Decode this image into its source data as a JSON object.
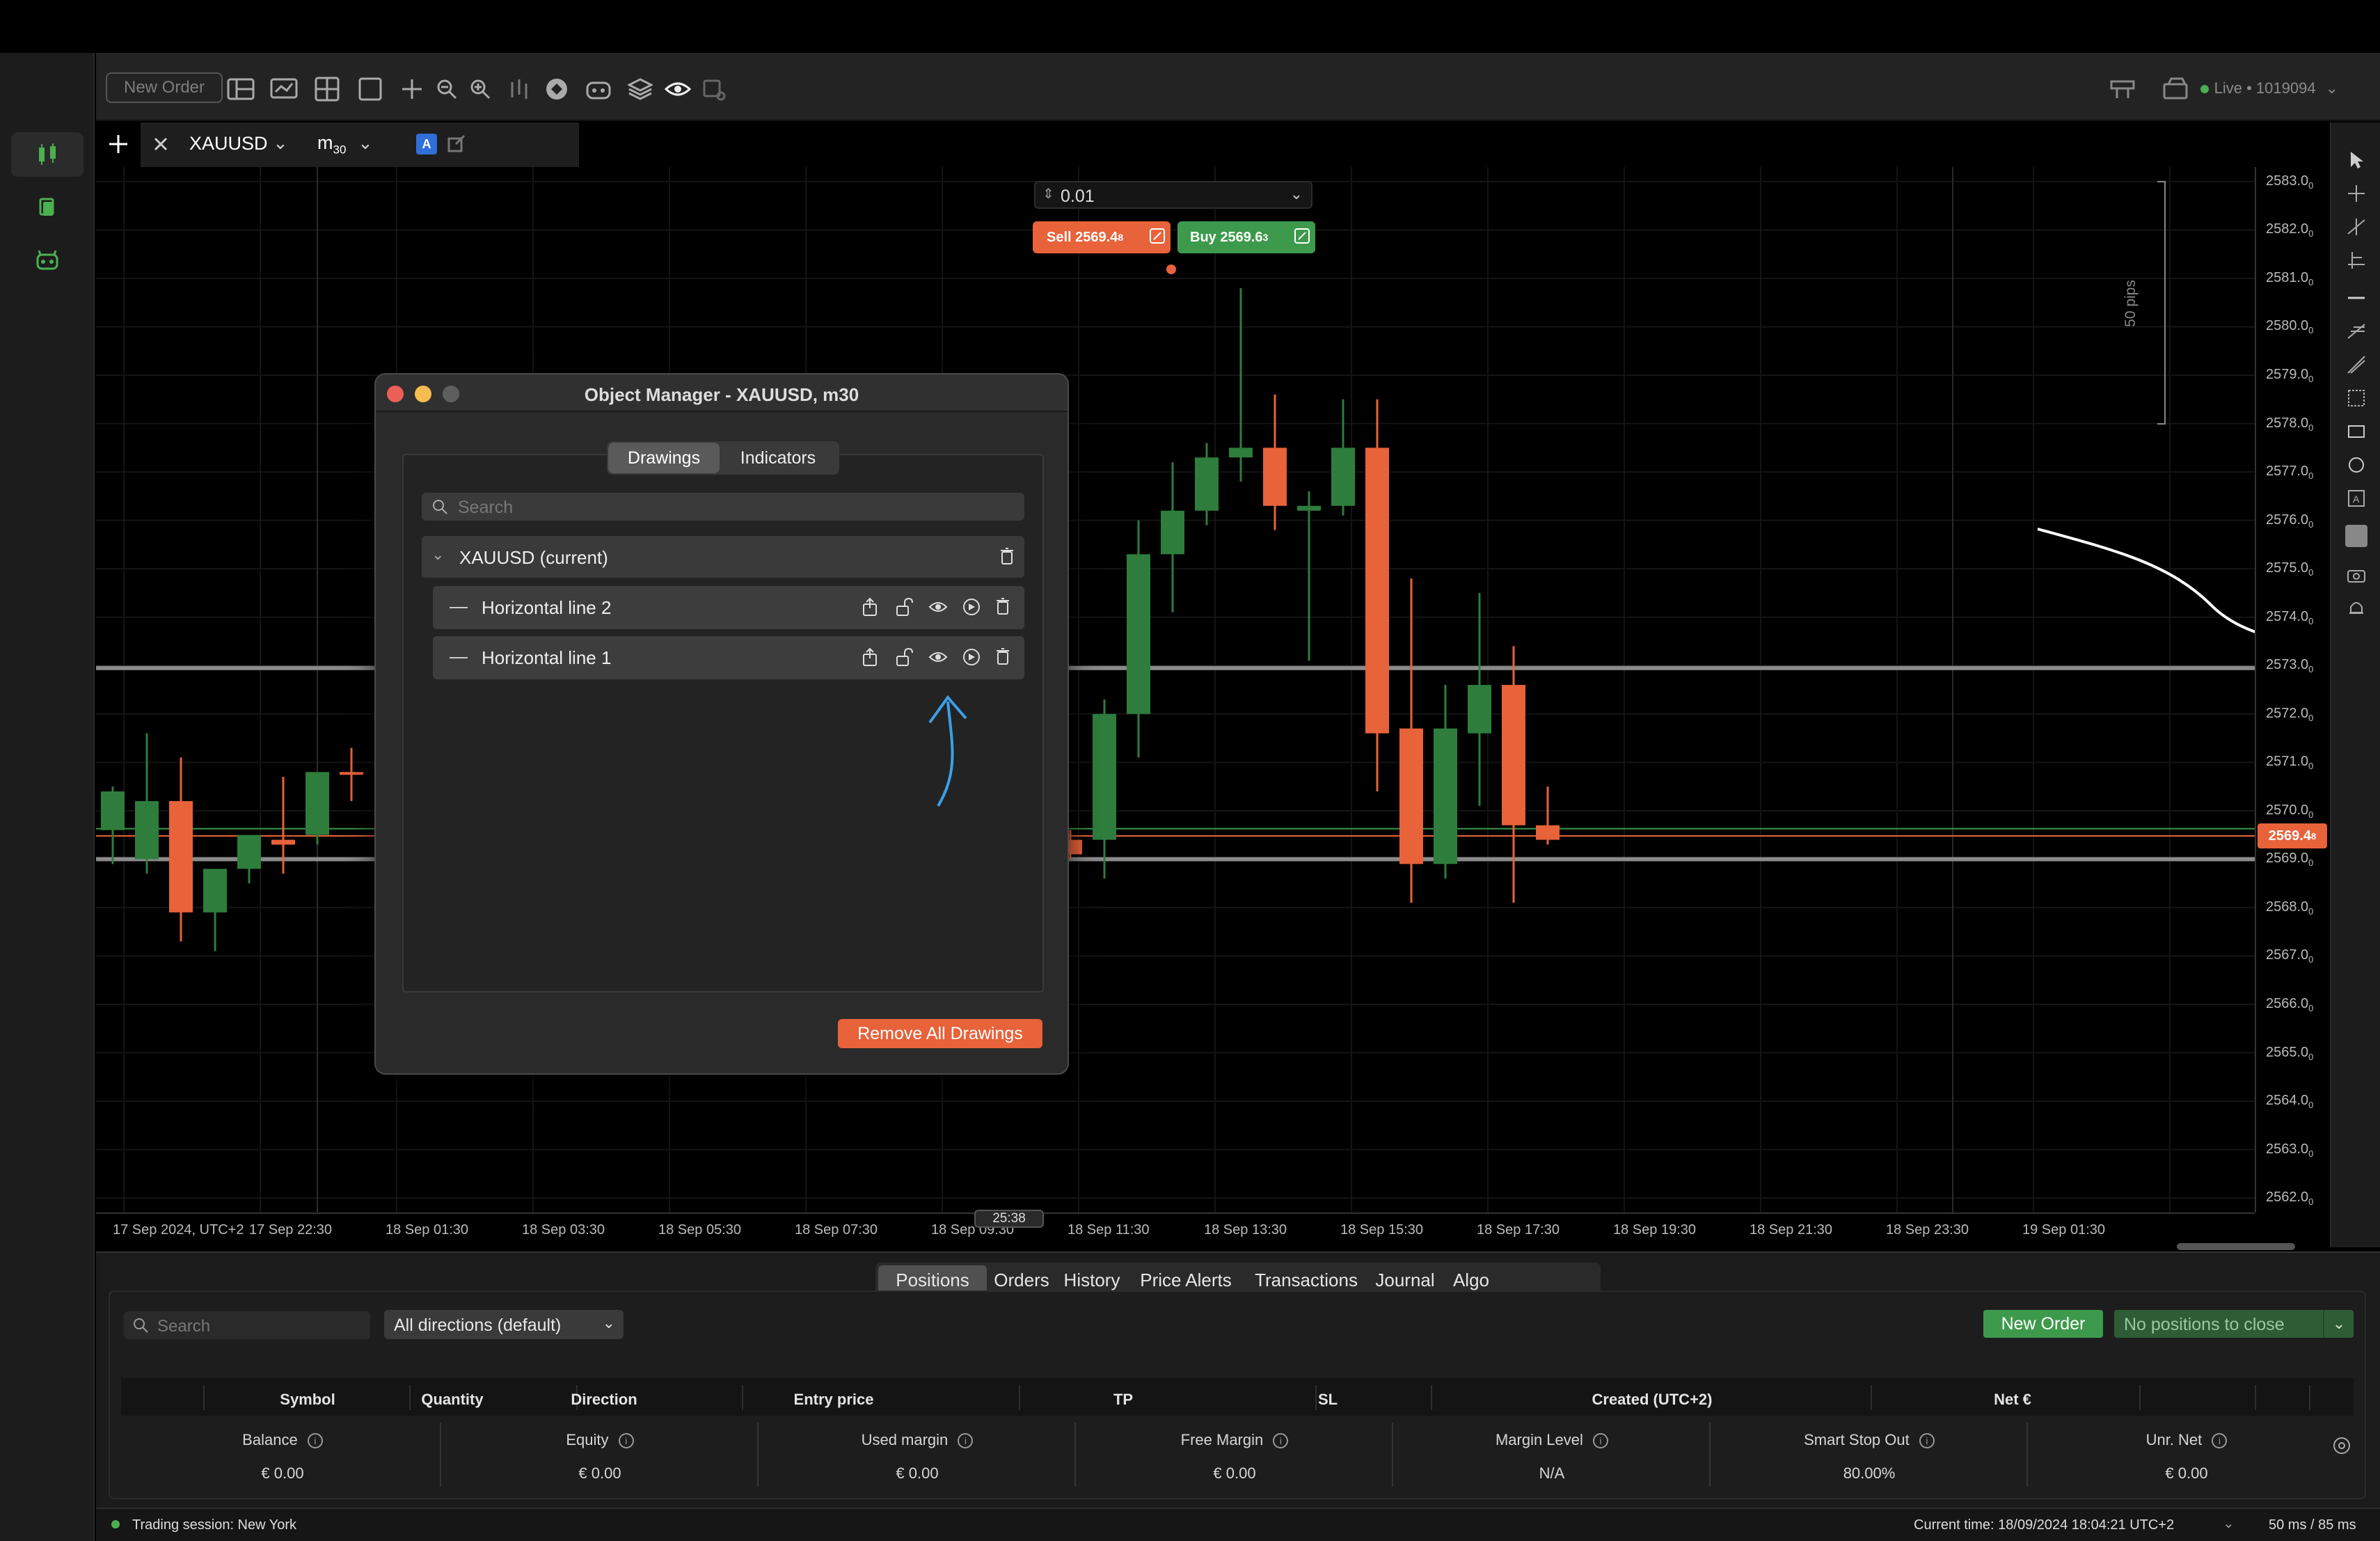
{
  "toolbar": {
    "new_order": "New Order",
    "live_status": "Live • 1019094"
  },
  "chart_tab": {
    "symbol": "XAUUSD",
    "timeframe_main": "m",
    "timeframe_sub": "30",
    "chart_label": "A"
  },
  "trade_widget": {
    "lot_size": "0.01",
    "sell_label": "Sell 2569.4",
    "sell_sup": "8",
    "buy_label": "Buy 2569.6",
    "buy_sup": "3"
  },
  "pips_label": "50 pips",
  "price_axis": {
    "ticks": [
      "2583.0",
      "2582.0",
      "2581.0",
      "2580.0",
      "2579.0",
      "2578.0",
      "2577.0",
      "2576.0",
      "2575.0",
      "2574.0",
      "2573.0",
      "2572.0",
      "2571.0",
      "2570.0",
      "2569.0",
      "2568.0",
      "2567.0",
      "2566.0",
      "2565.0",
      "2564.0",
      "2563.0",
      "2562.0"
    ],
    "tick_sup": "0",
    "current_price": "2569.4",
    "current_sup": "8"
  },
  "time_axis": {
    "labels": [
      "17 Sep 2024, UTC+2",
      "17 Sep 22:30",
      "18 Sep 01:30",
      "18 Sep 03:30",
      "18 Sep 05:30",
      "18 Sep 07:30",
      "18 Sep 09:30",
      "18 Sep 11:30",
      "18 Sep 13:30",
      "18 Sep 15:30",
      "18 Sep 17:30",
      "18 Sep 19:30",
      "18 Sep 21:30",
      "18 Sep 23:30",
      "19 Sep 01:30"
    ],
    "countdown": "25:38"
  },
  "chart_data": {
    "type": "candlestick",
    "symbol": "XAUUSD",
    "timeframe": "m30",
    "ylim": [
      2561.7,
      2583.3
    ],
    "horizontal_lines": [
      2572.95,
      2569.0
    ],
    "current_price": 2569.48,
    "candles_left": [
      {
        "o": 2569.6,
        "h": 2570.5,
        "l": 2568.9,
        "c": 2570.4
      },
      {
        "o": 2569.0,
        "h": 2571.6,
        "l": 2568.7,
        "c": 2570.2
      },
      {
        "o": 2570.2,
        "h": 2571.1,
        "l": 2567.3,
        "c": 2567.9
      },
      {
        "o": 2567.9,
        "h": 2568.4,
        "l": 2567.1,
        "c": 2568.8
      },
      {
        "o": 2568.8,
        "h": 2569.1,
        "l": 2568.5,
        "c": 2569.5
      },
      {
        "o": 2569.4,
        "h": 2570.7,
        "l": 2568.7,
        "c": 2569.3
      },
      {
        "o": 2569.5,
        "h": 2570.5,
        "l": 2569.3,
        "c": 2570.8
      },
      {
        "o": 2570.8,
        "h": 2571.3,
        "l": 2570.2,
        "c": 2570.75
      }
    ],
    "candles_right": [
      {
        "o": 2569.4,
        "h": 2569.6,
        "l": 2569.0,
        "c": 2569.1
      },
      {
        "o": 2569.4,
        "h": 2572.3,
        "l": 2568.6,
        "c": 2572.0
      },
      {
        "o": 2572.0,
        "h": 2576.0,
        "l": 2571.1,
        "c": 2575.3
      },
      {
        "o": 2575.3,
        "h": 2577.2,
        "l": 2574.1,
        "c": 2576.2
      },
      {
        "o": 2576.2,
        "h": 2577.6,
        "l": 2575.9,
        "c": 2577.3
      },
      {
        "o": 2577.3,
        "h": 2580.8,
        "l": 2576.8,
        "c": 2577.5
      },
      {
        "o": 2577.5,
        "h": 2578.6,
        "l": 2575.8,
        "c": 2576.3
      },
      {
        "o": 2576.2,
        "h": 2576.6,
        "l": 2573.1,
        "c": 2576.3
      },
      {
        "o": 2576.3,
        "h": 2578.5,
        "l": 2576.1,
        "c": 2577.5
      },
      {
        "o": 2577.5,
        "h": 2578.5,
        "l": 2570.4,
        "c": 2571.6
      },
      {
        "o": 2571.7,
        "h": 2574.8,
        "l": 2568.1,
        "c": 2568.9
      },
      {
        "o": 2568.9,
        "h": 2572.6,
        "l": 2568.6,
        "c": 2571.7
      },
      {
        "o": 2571.6,
        "h": 2574.5,
        "l": 2570.1,
        "c": 2572.6
      },
      {
        "o": 2572.6,
        "h": 2573.4,
        "l": 2568.1,
        "c": 2569.7
      },
      {
        "o": 2569.7,
        "h": 2570.5,
        "l": 2569.3,
        "c": 2569.4
      }
    ]
  },
  "dialog": {
    "title": "Object Manager - XAUUSD, m30",
    "tabs": [
      "Drawings",
      "Indicators"
    ],
    "search_placeholder": "Search",
    "group_label": "XAUUSD (current)",
    "items": [
      "Horizontal line 2",
      "Horizontal line 1"
    ],
    "remove_all": "Remove All Drawings"
  },
  "bottom": {
    "tabs": [
      "Positions",
      "Orders",
      "History",
      "Price Alerts",
      "Transactions",
      "Journal",
      "Algo"
    ],
    "search_placeholder": "Search",
    "directions": "All directions (default)",
    "new_order": "New Order",
    "no_positions": "No positions to close",
    "columns": [
      "Symbol",
      "Quantity",
      "Direction",
      "Entry price",
      "TP",
      "SL",
      "Created (UTC+2)",
      "Net €"
    ],
    "metrics": [
      {
        "label": "Balance",
        "value": "€ 0.00"
      },
      {
        "label": "Equity",
        "value": "€ 0.00"
      },
      {
        "label": "Used margin",
        "value": "€ 0.00"
      },
      {
        "label": "Free Margin",
        "value": "€ 0.00"
      },
      {
        "label": "Margin Level",
        "value": "N/A"
      },
      {
        "label": "Smart Stop Out",
        "value": "80.00%"
      },
      {
        "label": "Unr. Net",
        "value": "€ 0.00"
      }
    ]
  },
  "status": {
    "session": "Trading session: New York",
    "current_time": "Current time: 18/09/2024 18:04:21  UTC+2",
    "latency": "50 ms / 85 ms"
  },
  "colors": {
    "bull": "#2e7d3c",
    "bear": "#e8623a",
    "accent_green": "#4caf50",
    "sell": "#e8623a",
    "buy": "#3d9a4c"
  }
}
